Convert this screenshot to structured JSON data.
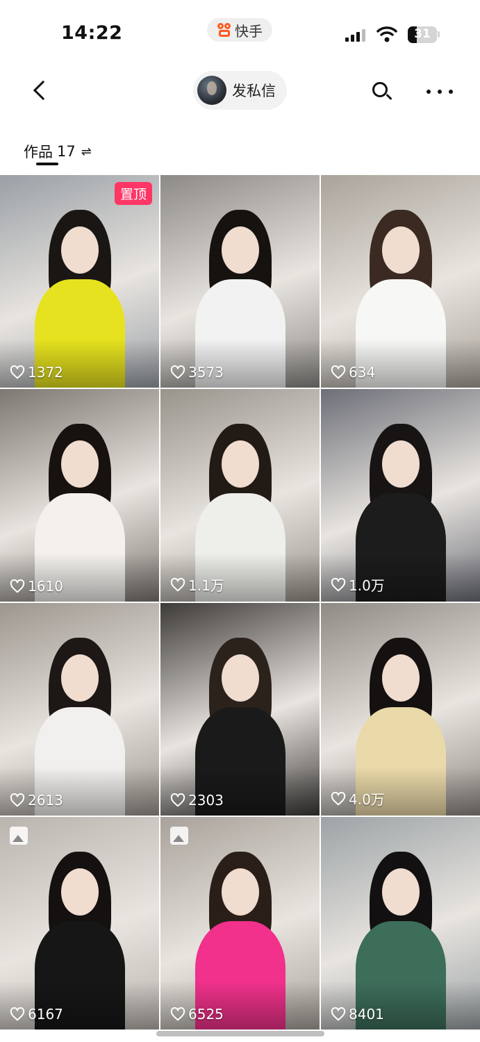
{
  "status_bar": {
    "time": "14:22",
    "app_name": "快手",
    "battery": "31",
    "battery_level": 0.31
  },
  "nav": {
    "dm_label": "发私信"
  },
  "works_tab": {
    "label": "作品",
    "count": "17",
    "sort_icon": "⇌"
  },
  "grid": {
    "tiles": [
      {
        "likes": "1372",
        "badge": "置顶",
        "photo": false,
        "bg": "#9aa0a6",
        "shirt": "#e6e21f",
        "hair": "#1a1614"
      },
      {
        "likes": "3573",
        "photo": false,
        "bg": "#8d8a86",
        "shirt": "#f2f2f2",
        "hair": "#151210"
      },
      {
        "likes": "634",
        "photo": false,
        "bg": "#a9a39a",
        "shirt": "#f7f7f5",
        "hair": "#3a2a22"
      },
      {
        "likes": "1610",
        "photo": false,
        "bg": "#7e7872",
        "shirt": "#f4f1ed",
        "hair": "#17120f"
      },
      {
        "likes": "1.1万",
        "photo": false,
        "bg": "#98938b",
        "shirt": "#eeeeea",
        "hair": "#221a15"
      },
      {
        "likes": "1.0万",
        "photo": false,
        "bg": "#6d6f78",
        "shirt": "#1c1c1c",
        "hair": "#181414"
      },
      {
        "likes": "2613",
        "photo": false,
        "bg": "#9d968f",
        "shirt": "#f2f0ee",
        "hair": "#1d1815"
      },
      {
        "likes": "2303",
        "photo": false,
        "bg": "#3d3a38",
        "shirt": "#1a1a1a",
        "hair": "#2c221c"
      },
      {
        "likes": "4.0万",
        "photo": false,
        "bg": "#8f8a84",
        "shirt": "#ead9a9",
        "hair": "#141110"
      },
      {
        "likes": "6167",
        "photo": true,
        "bg": "#b9b4ae",
        "shirt": "#161616",
        "hair": "#141110"
      },
      {
        "likes": "6525",
        "photo": true,
        "bg": "#a9a29b",
        "shirt": "#f1318b",
        "hair": "#2a1e18"
      },
      {
        "likes": "8401",
        "photo": false,
        "bg": "#9ca3a6",
        "shirt": "#3d6e5a",
        "hair": "#121010"
      }
    ]
  }
}
